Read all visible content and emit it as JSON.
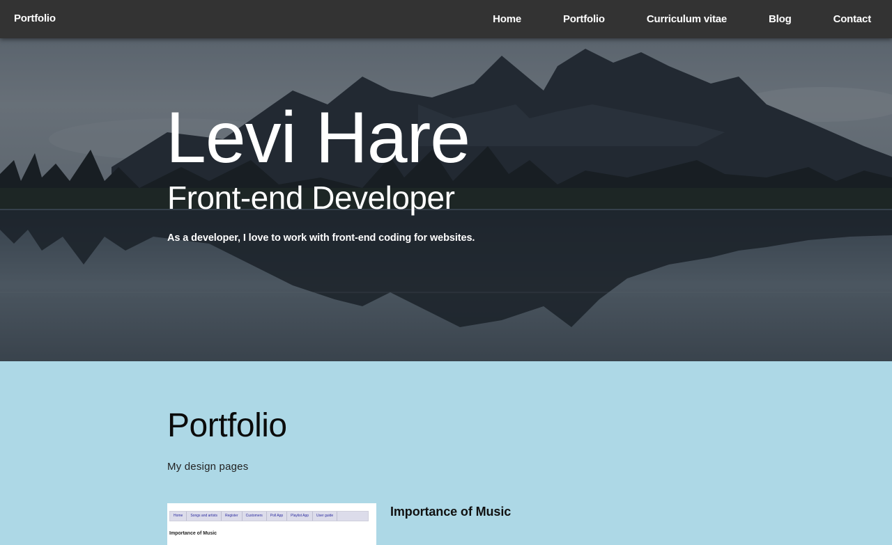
{
  "nav": {
    "brand": "Portfolio",
    "links": [
      "Home",
      "Portfolio",
      "Curriculum vitae",
      "Blog",
      "Contact"
    ],
    "background": "#333333"
  },
  "hero": {
    "name": "Levi Hare",
    "role": "Front-end Developer",
    "description": "As a developer, I love to work with front-end coding for websites."
  },
  "portfolio": {
    "title": "Portfolio",
    "subtitle": "My design pages",
    "background": "#add8e6",
    "items": [
      {
        "title": "Importance of Music",
        "thumbnail": {
          "nav": [
            "Home",
            "Songs and artists",
            "Register",
            "Customers",
            "Poll App",
            "Playlist App",
            "User guide"
          ],
          "heading": "Importance of Music"
        }
      }
    ]
  }
}
